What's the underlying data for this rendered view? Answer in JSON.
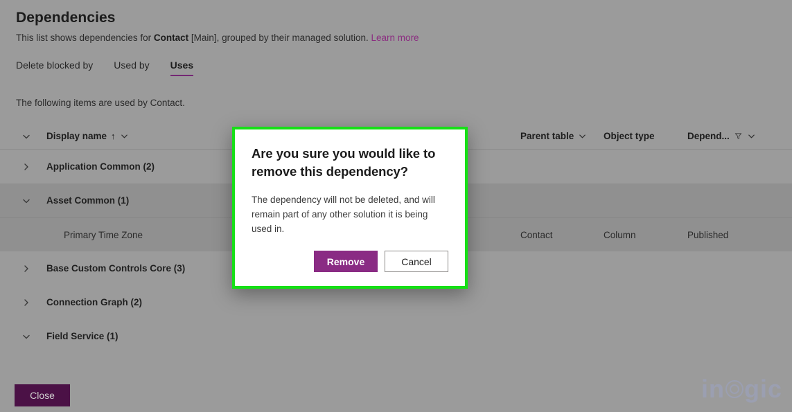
{
  "header": {
    "title": "Dependencies",
    "subtitle_prefix": "This list shows dependencies for ",
    "subtitle_entity": "Contact",
    "subtitle_suffix": " [Main], grouped by their managed solution. ",
    "learn_more": "Learn more"
  },
  "tabs": [
    {
      "label": "Delete blocked by",
      "active": false
    },
    {
      "label": "Used by",
      "active": false
    },
    {
      "label": "Uses",
      "active": true
    }
  ],
  "list_description": "The following items are used by Contact.",
  "grid": {
    "columns": {
      "display_name": "Display name",
      "sort_indicator": "↑",
      "parent_table": "Parent table",
      "object_type": "Object type",
      "dependency": "Depend..."
    },
    "rows": [
      {
        "kind": "group",
        "expanded": false,
        "name": "Application Common (2)",
        "parent_table": "",
        "object_type": "",
        "dependency": "",
        "selected": false
      },
      {
        "kind": "group",
        "expanded": true,
        "name": "Asset Common (1)",
        "parent_table": "",
        "object_type": "",
        "dependency": "",
        "selected": true
      },
      {
        "kind": "child",
        "expanded": null,
        "name": "Primary Time Zone",
        "parent_table": "Contact",
        "object_type": "Column",
        "dependency": "Published",
        "selected": true
      },
      {
        "kind": "group",
        "expanded": false,
        "name": "Base Custom Controls Core (3)",
        "parent_table": "",
        "object_type": "",
        "dependency": "",
        "selected": false
      },
      {
        "kind": "group",
        "expanded": false,
        "name": "Connection Graph (2)",
        "parent_table": "",
        "object_type": "",
        "dependency": "",
        "selected": false
      },
      {
        "kind": "group",
        "expanded": true,
        "name": "Field Service (1)",
        "parent_table": "",
        "object_type": "",
        "dependency": "",
        "selected": false
      }
    ]
  },
  "footer": {
    "close_label": "Close"
  },
  "watermark": {
    "text_before": "in",
    "text_after": "gic"
  },
  "dialog": {
    "title": "Are you sure you would like to remove this dependency?",
    "body": "The dependency will not be deleted, and will remain part of any other solution it is being used in.",
    "remove_label": "Remove",
    "cancel_label": "Cancel"
  },
  "colors": {
    "accent_purple": "#8a2b84",
    "close_purple": "#4b1146",
    "link_purple": "#8b2d80",
    "highlight_green": "#16e016",
    "scrim_gray": "#9b9b9b"
  }
}
